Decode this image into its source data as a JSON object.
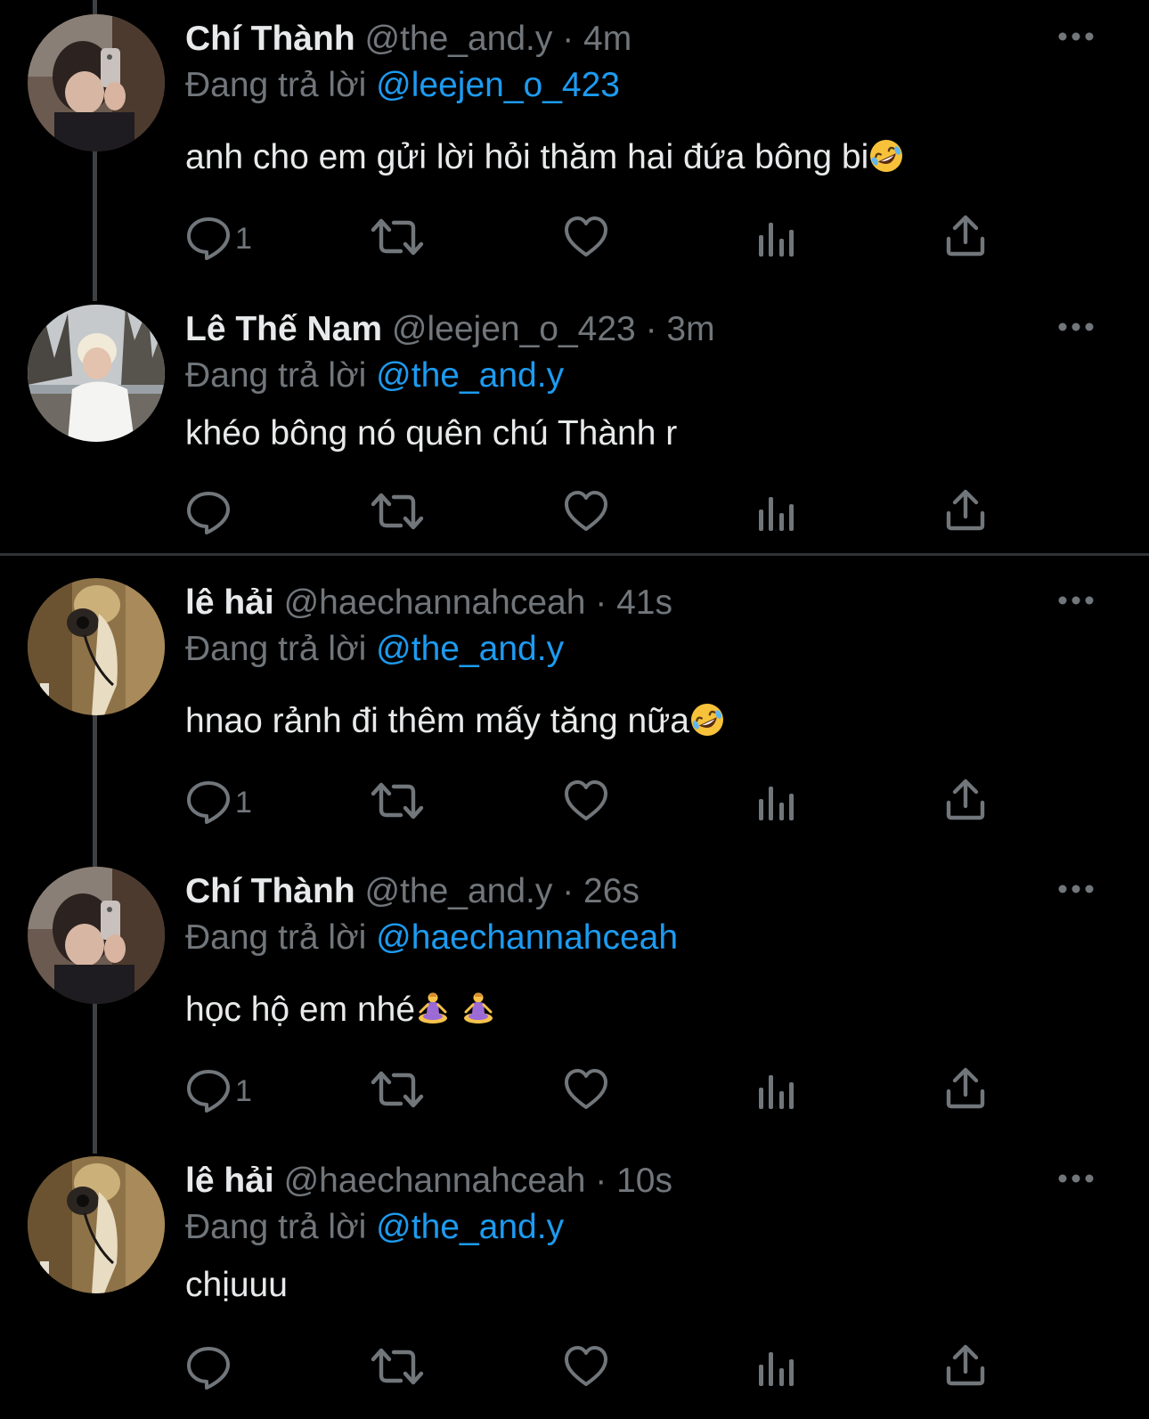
{
  "tweets": [
    {
      "name": "Chí Thành",
      "handle": "@the_and.y",
      "time": "· 4m",
      "replying_label": "Đang trả lời",
      "replying_to": "@leejen_o_423",
      "text": "anh cho em gửi lời hỏi thăm hai đứa bông bi",
      "emoji": "rolling-on-floor-laughing",
      "reply_count": "1"
    },
    {
      "name": "Lê Thế Nam",
      "handle": "@leejen_o_423",
      "time": "· 3m",
      "replying_label": "Đang trả lời",
      "replying_to": "@the_and.y",
      "text": "khéo bông nó quên chú Thành r",
      "emoji": "",
      "reply_count": ""
    },
    {
      "name": "lê hải",
      "handle": "@haechannahceah",
      "time": "· 41s",
      "replying_label": "Đang trả lời",
      "replying_to": "@the_and.y",
      "text": "hnao rảnh đi thêm mấy tăng nữa",
      "emoji": "rolling-on-floor-laughing",
      "reply_count": "1"
    },
    {
      "name": "Chí Thành",
      "handle": "@the_and.y",
      "time": "· 26s",
      "replying_label": "Đang trả lời",
      "replying_to": "@haechannahceah",
      "text": "học hộ em nhé",
      "emoji": "person-in-lotus-position x2",
      "reply_count": "1"
    },
    {
      "name": "lê hải",
      "handle": "@haechannahceah",
      "time": "· 10s",
      "replying_label": "Đang trả lời",
      "replying_to": "@the_and.y",
      "text": "chịuuu",
      "emoji": "",
      "reply_count": ""
    }
  ],
  "icons": {
    "more": "more-horizontal-icon",
    "reply": "reply-bubble-icon",
    "retweet": "retweet-icon",
    "like": "heart-icon",
    "views": "views-bar-chart-icon",
    "share": "share-upload-icon"
  },
  "colors": {
    "background": "#000000",
    "text": "#e7e9ea",
    "secondary": "#71767b",
    "mention": "#1d9bf0",
    "thread_line": "#3e4144",
    "divider": "#2f3336"
  }
}
